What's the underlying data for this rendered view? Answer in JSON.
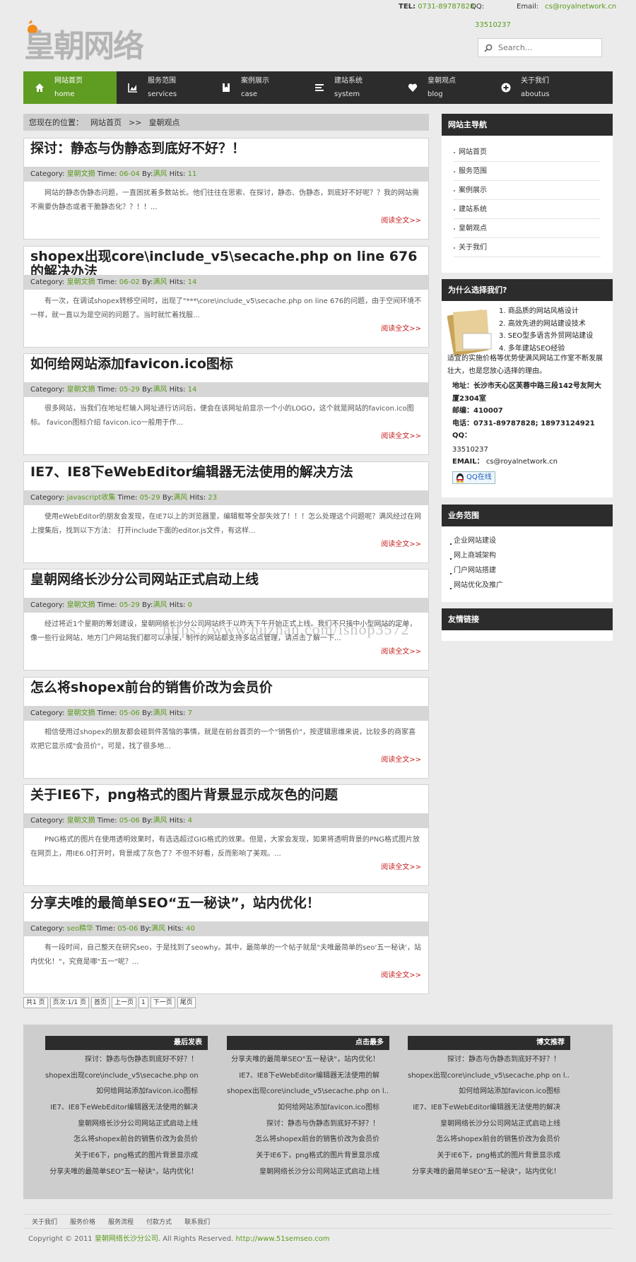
{
  "site": {
    "logo_text": "皇朝网络"
  },
  "contact": {
    "tel_label": "TEL:",
    "tel": "0731-89787828",
    "qq_label": "QQ:",
    "qq": "33510237",
    "email_label": "Email:",
    "email": "cs@royalnetwork.cn"
  },
  "search": {
    "placeholder": "Search..."
  },
  "nav": [
    {
      "cn": "网站首页",
      "en": "home",
      "icon": "home-icon"
    },
    {
      "cn": "服务范围",
      "en": "services",
      "icon": "chart-icon"
    },
    {
      "cn": "案例展示",
      "en": "case",
      "icon": "bookmark-icon"
    },
    {
      "cn": "建站系统",
      "en": "system",
      "icon": "list-icon"
    },
    {
      "cn": "皇朝观点",
      "en": "blog",
      "icon": "heart-icon"
    },
    {
      "cn": "关于我们",
      "en": "aboutus",
      "icon": "plus-circle-icon"
    }
  ],
  "breadcrumb": {
    "label": "您现在的位置：",
    "home": "网站首页",
    "sep": ">>",
    "current": "皇朝观点"
  },
  "posts": [
    {
      "title": "探讨：静态与伪静态到底好不好？！",
      "category": "皇朝文摘",
      "time": "06-04",
      "by": "满风",
      "hits": "11",
      "excerpt": "网站的静态伪静态问题，一直困扰着多数站长。他们往往在思索、在探讨，静态、伪静态，到底好不好呢？？我的网站需不需要伪静态或者干脆静态化？？！！..."
    },
    {
      "title": "shopex出现core\\include_v5\\secache.php on line 676的解决办法",
      "category": "皇朝文摘",
      "time": "06-02",
      "by": "满风",
      "hits": "14",
      "excerpt": "有一次，在调试shopex转移空间时，出现了\"***\\core\\include_v5\\secache.php on line 676的问题，由于空间环境不一样，就一直以为是空间的问题了。当时就忙着找服..."
    },
    {
      "title": "如何给网站添加favicon.ico图标",
      "category": "皇朝文摘",
      "time": "05-29",
      "by": "满风",
      "hits": "14",
      "excerpt": "很多网站，当我们在地址栏输入网址进行访问后，便会在该网址前显示一个小的LOGO，这个就是网站的favicon.ico图标。  favicon图标介绍 favicon.ico一般用于作..."
    },
    {
      "title": "IE7、IE8下eWebEditor编辑器无法使用的解决方法",
      "category": "javascript收集",
      "time": "05-29",
      "by": "满风",
      "hits": "23",
      "excerpt": "使用eWebEditor的朋友会发现，在IE7以上的浏览器里，编辑框等全部失效了！！！怎么处理这个问题呢？满风经过在网上搜集后，找到以下方法：  打开include下面的editor.js文件，有这样..."
    },
    {
      "title": "皇朝网络长沙分公司网站正式启动上线",
      "category": "皇朝文摘",
      "time": "05-29",
      "by": "满风",
      "hits": "0",
      "excerpt": "经过将近1个星期的筹划建设，皇朝网络长沙分公司网站终于以昨天下午开始正式上线。我们不只接中小型网站的定单，像一些行业网站，地方门户网站我们都可以承接，制作的网站都支持多站点管理，请点击了解一下..."
    },
    {
      "title": "怎么将shopex前台的销售价改为会员价",
      "category": "皇朝文摘",
      "time": "05-06",
      "by": "满风",
      "hits": "7",
      "excerpt": "相信使用过shopex的朋友都会碰到件苦恼的事情，就是在前台首页的一个\"销售价\"，按逻辑思维来说，比较多的商家喜欢把它显示成\"会员价\"，可是，找了很多地..."
    },
    {
      "title": "关于IE6下，png格式的图片背景显示成灰色的问题",
      "category": "皇朝文摘",
      "time": "05-06",
      "by": "满风",
      "hits": "4",
      "excerpt": "PNG格式的图片在使用透明效果时，有选选超过GIG格式的效果。但是，大家会发现，如果将透明背景的PNG格式图片放在网页上，用IE6.0打开时，背景成了灰色了？不但不好看，反而影响了美观。..."
    },
    {
      "title": "分享夫唯的最简单SEO“五一秘诀”，站内优化！",
      "category": "seo精华",
      "time": "05-06",
      "by": "满风",
      "hits": "40",
      "excerpt": "有一段时间，自己整天在研究seo，于是找到了seowhy。其中，最简单的一个帖子就是\"夫唯最简单的seo'五一秘诀'，站内优化！\"，究竟是哪\"五一\"呢？..."
    }
  ],
  "post_labels": {
    "category": "Category:",
    "time": "Time:",
    "by": "By:",
    "hits": "Hits:",
    "read_more": "阅读全文>>"
  },
  "pager": [
    "共1 页",
    "页次:1/1 页",
    "首页",
    "上一页",
    "1",
    "下一页",
    "尾页"
  ],
  "sidebar": {
    "main_nav_title": "网站主导航",
    "main_nav": [
      "网站首页",
      "服务范围",
      "案例展示",
      "建站系统",
      "皇朝观点",
      "关于我们"
    ],
    "why_title": "为什么选择我们?",
    "why_list": [
      "1. 商品质的网站风格设计",
      "2. 高效先进的网站建设技术",
      "3. SEO型多语言外贸网站建设",
      "4. 多年建站SEO经验"
    ],
    "why_text": "适宜的实施价格等优势使满风网站工作室不断发展壮大，也是您放心选择的理由。",
    "address": "地址：长沙市天心区芙蓉中路三段142号友阿大厦2304室",
    "postcode": "邮编：410007",
    "phone": "电话：0731-89787828; 18973124921",
    "qq_label": "QQ：",
    "qq": "33510237",
    "email_label": "EMAIL：",
    "email": "cs@royalnetwork.cn",
    "qq_online": "QQ在线",
    "biz_title": "业务范围",
    "biz": [
      "企业网站建设",
      "网上商城架构",
      "门户网站搭建",
      "网站优化及推广"
    ],
    "links_title": "友情链接"
  },
  "watermark": "https://www.huzhan.com/ishop3572",
  "footer_cols": [
    {
      "title": "最后发表",
      "items": [
        "探讨：静态与伪静态到底好不好？！",
        "shopex出现core\\include_v5\\secache.php on",
        "如何给网站添加favicon.ico图标",
        "IE7、IE8下eWebEditor编辑器无法使用的解决",
        "皇朝网络长沙分公司网站正式启动上线",
        "怎么将shopex前台的销售价改为会员价",
        "关于IE6下，png格式的图片背景显示成",
        "分享夫唯的最简单SEO\"五一秘诀\"，站内优化！"
      ]
    },
    {
      "title": "点击最多",
      "items": [
        "分享夫唯的最简单SEO\"五一秘诀\"，站内优化！",
        "IE7、IE8下eWebEditor编辑器无法使用的解",
        "shopex出现core\\include_v5\\secache.php on l...",
        "如何给网站添加favicon.ico图标",
        "探讨：静态与伪静态到底好不好？！",
        "怎么将shopex前台的销售价改为会员价",
        "关于IE6下，png格式的图片背景显示成",
        "皇朝网络长沙分公司网站正式启动上线"
      ]
    },
    {
      "title": "博文推荐",
      "items": [
        "探讨：静态与伪静态到底好不好？！",
        "shopex出现core\\include_v5\\secache.php on l...",
        "如何给网站添加favicon.ico图标",
        "IE7、IE8下eWebEditor编辑器无法使用的解决",
        "皇朝网络长沙分公司网站正式启动上线",
        "怎么将shopex前台的销售价改为会员价",
        "关于IE6下，png格式的图片背景显示成",
        "分享夫唯的最简单SEO\"五一秘诀\"，站内优化！"
      ]
    }
  ],
  "footer_links": [
    "关于我们",
    "服务价格",
    "服务流程",
    "付款方式",
    "联系我们"
  ],
  "copyright": {
    "prefix": "Copyright © 2011",
    "company": "皇朝网络长沙分公司",
    "middle": ". All Rights Reserved.",
    "url": "http://www.51semseo.com"
  },
  "colors": {
    "accent": "#5f9c22",
    "dark": "#2c2c2c",
    "link_red": "#c81e1e"
  }
}
